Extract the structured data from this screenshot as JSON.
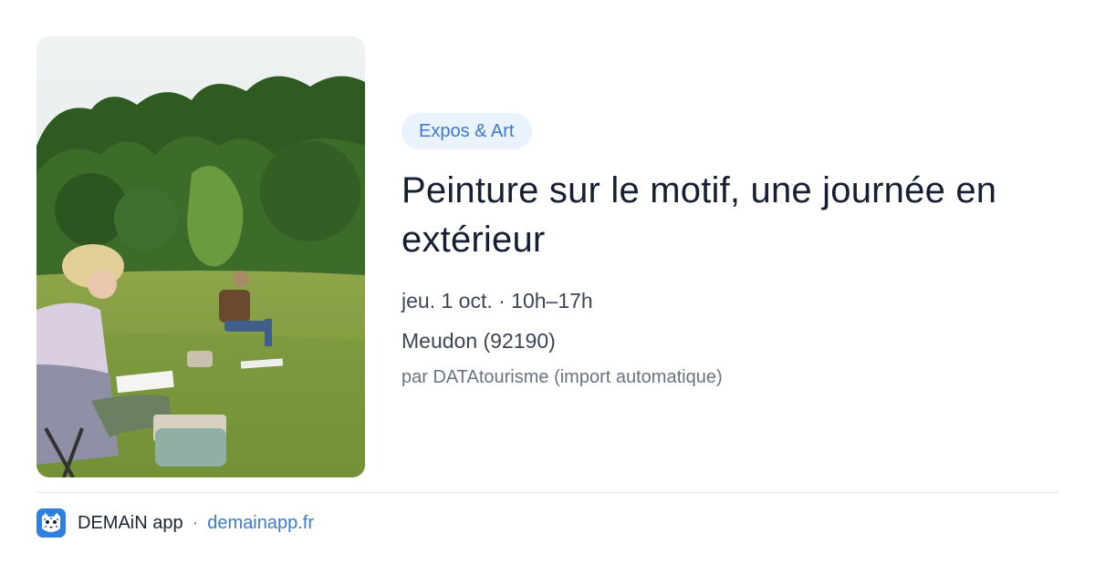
{
  "event": {
    "category": "Expos & Art",
    "title": "Peinture sur le motif, une journée en extérieur",
    "datetime": "jeu. 1 oct. · 10h–17h",
    "location": "Meudon (92190)",
    "source": "par DATAtourisme (import automatique)"
  },
  "photo": {
    "description_icon": "landscape-painting-photo"
  },
  "footer": {
    "app_icon": "leopard-app-icon",
    "app_name": "DEMAiN app",
    "separator": "·",
    "url": "demainapp.fr"
  },
  "colors": {
    "accent": "#3b79d6",
    "badge_bg": "#eaf2fd",
    "title": "#172033",
    "meta": "#3c4656",
    "muted": "#697383",
    "divider": "#dfe3e8"
  }
}
